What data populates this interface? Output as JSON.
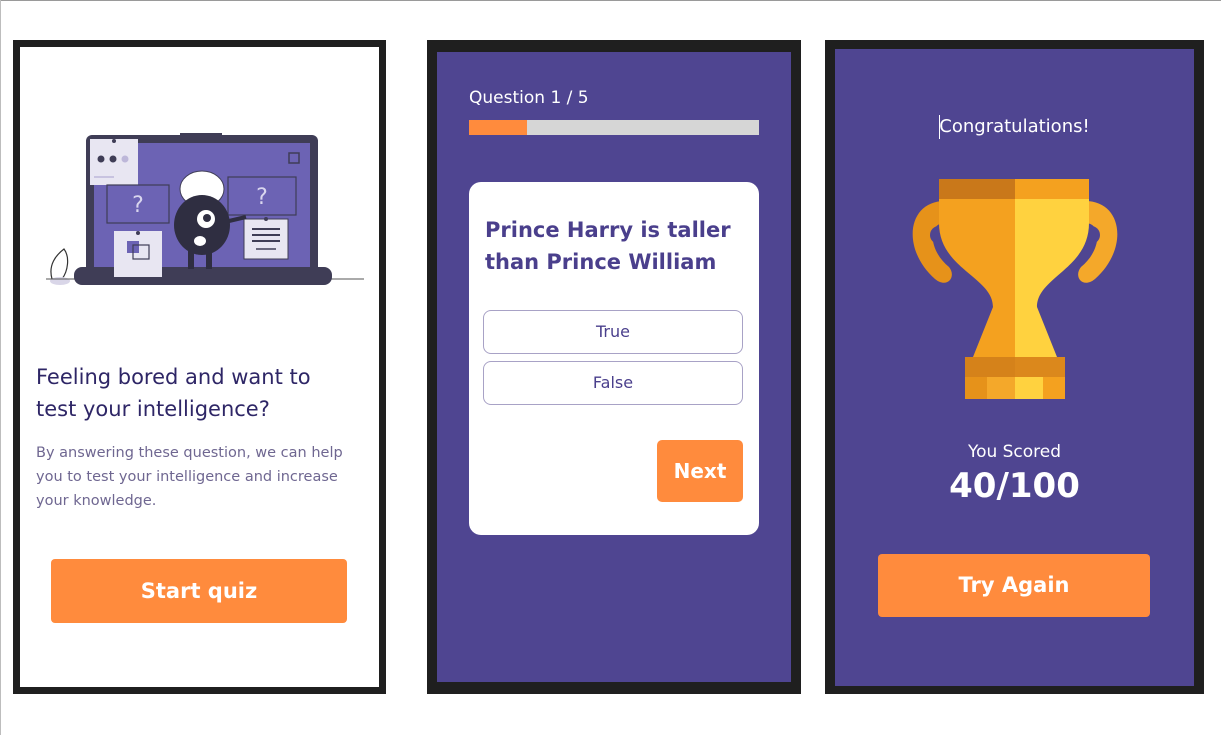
{
  "screen_intro": {
    "heading": "Feeling bored and want to test your intelligence?",
    "description": "By answering these question, we can help you to test your intelligence and increase your knowledge.",
    "start_button": "Start quiz",
    "illustration_marks": [
      "?",
      "?"
    ]
  },
  "screen_question": {
    "progress_label": "Question 1 / 5",
    "progress_fraction": 0.2,
    "question": "Prince Harry is taller than Prince William",
    "options": [
      "True",
      "False"
    ],
    "next_button": "Next"
  },
  "screen_result": {
    "title": "Congratulations!",
    "scored_label": "You Scored",
    "score": "40/100",
    "try_again_button": "Try Again"
  },
  "colors": {
    "accent": "#ff8b3d",
    "primary": "#4f4591",
    "heading_text": "#2e2666",
    "frame": "#1f1f1f"
  },
  "icons": [
    "laptop-illustration",
    "trophy-icon"
  ]
}
